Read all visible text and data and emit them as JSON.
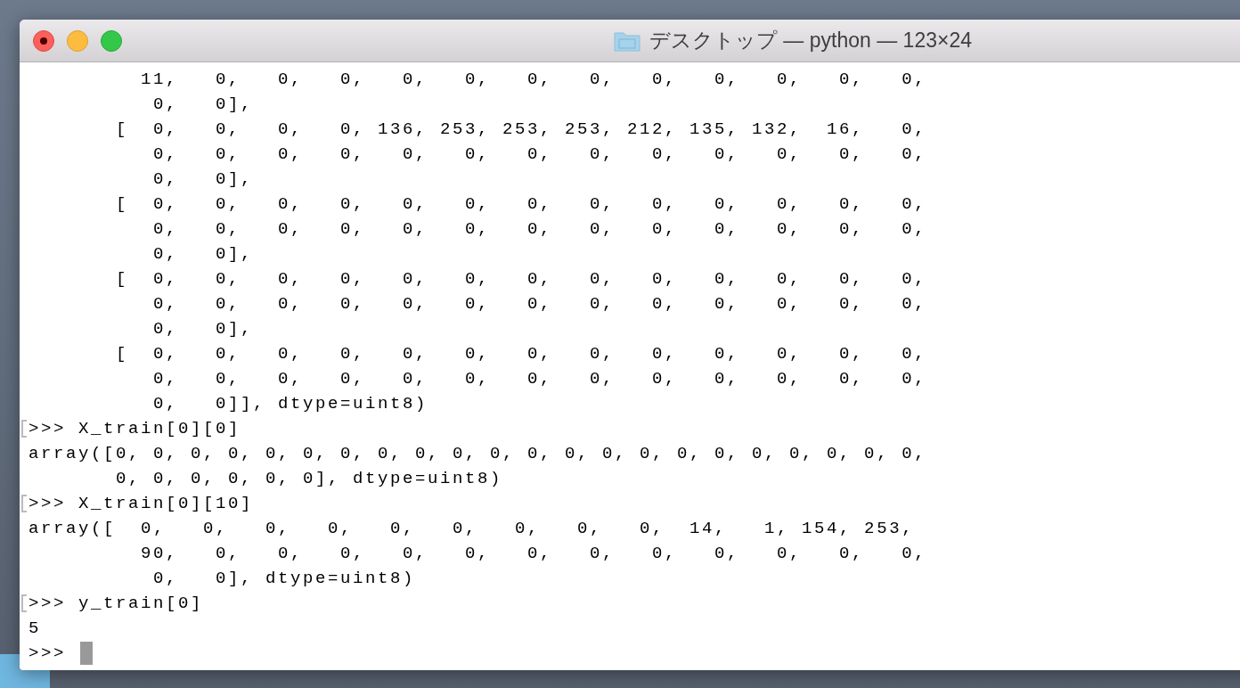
{
  "window": {
    "title": "デスクトップ — python — 123×24"
  },
  "terminal": {
    "lines": [
      {
        "kind": "output",
        "text": "         11,   0,   0,   0,   0,   0,   0,   0,   0,   0,   0,   0,   0,"
      },
      {
        "kind": "output",
        "text": "          0,   0],"
      },
      {
        "kind": "output",
        "text": "       [  0,   0,   0,   0, 136, 253, 253, 253, 212, 135, 132,  16,   0,"
      },
      {
        "kind": "output",
        "text": "          0,   0,   0,   0,   0,   0,   0,   0,   0,   0,   0,   0,   0,"
      },
      {
        "kind": "output",
        "text": "          0,   0],"
      },
      {
        "kind": "output",
        "text": "       [  0,   0,   0,   0,   0,   0,   0,   0,   0,   0,   0,   0,   0,"
      },
      {
        "kind": "output",
        "text": "          0,   0,   0,   0,   0,   0,   0,   0,   0,   0,   0,   0,   0,"
      },
      {
        "kind": "output",
        "text": "          0,   0],"
      },
      {
        "kind": "output",
        "text": "       [  0,   0,   0,   0,   0,   0,   0,   0,   0,   0,   0,   0,   0,"
      },
      {
        "kind": "output",
        "text": "          0,   0,   0,   0,   0,   0,   0,   0,   0,   0,   0,   0,   0,"
      },
      {
        "kind": "output",
        "text": "          0,   0],"
      },
      {
        "kind": "output",
        "text": "       [  0,   0,   0,   0,   0,   0,   0,   0,   0,   0,   0,   0,   0,"
      },
      {
        "kind": "output",
        "text": "          0,   0,   0,   0,   0,   0,   0,   0,   0,   0,   0,   0,   0,"
      },
      {
        "kind": "output",
        "text": "          0,   0]], dtype=uint8)"
      },
      {
        "kind": "input",
        "marked": true,
        "text": ">>> X_train[0][0]"
      },
      {
        "kind": "output",
        "text": "array([0, 0, 0, 0, 0, 0, 0, 0, 0, 0, 0, 0, 0, 0, 0, 0, 0, 0, 0, 0, 0, 0,"
      },
      {
        "kind": "output",
        "text": "       0, 0, 0, 0, 0, 0], dtype=uint8)"
      },
      {
        "kind": "input",
        "marked": true,
        "text": ">>> X_train[0][10]"
      },
      {
        "kind": "output",
        "text": "array([  0,   0,   0,   0,   0,   0,   0,   0,   0,  14,   1, 154, 253,"
      },
      {
        "kind": "output",
        "text": "         90,   0,   0,   0,   0,   0,   0,   0,   0,   0,   0,   0,   0,"
      },
      {
        "kind": "output",
        "text": "          0,   0], dtype=uint8)"
      },
      {
        "kind": "input",
        "marked": true,
        "text": ">>> y_train[0]"
      },
      {
        "kind": "output",
        "text": "5"
      },
      {
        "kind": "input",
        "marked": false,
        "text": ">>>"
      }
    ]
  }
}
